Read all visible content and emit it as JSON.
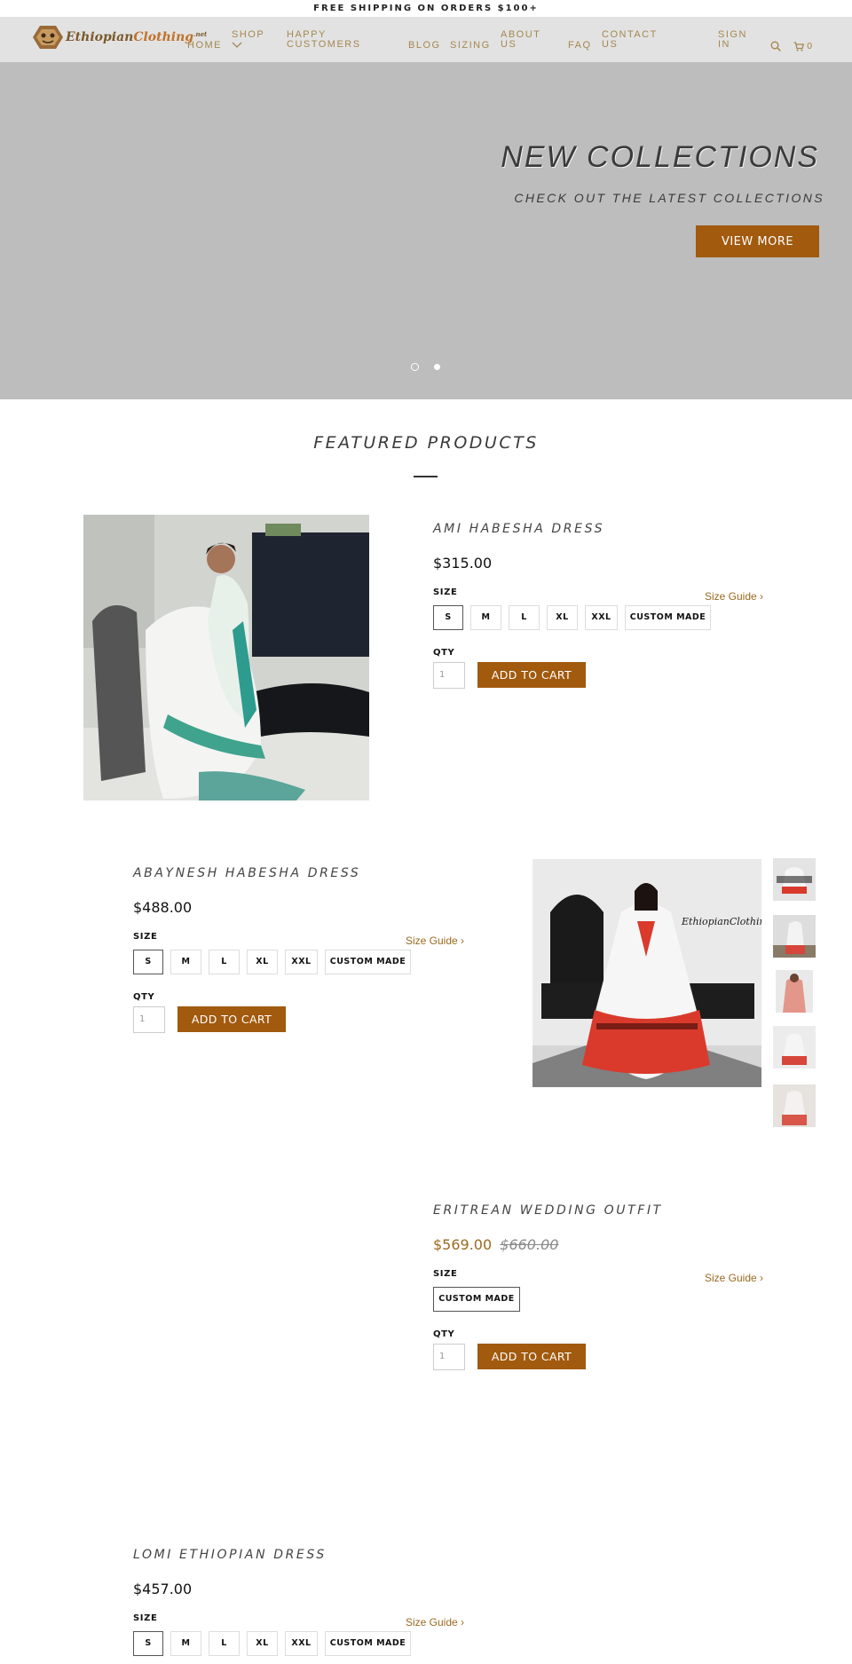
{
  "announcement": "FREE SHIPPING ON ORDERS $100+",
  "logo": {
    "text_main": "Ethiopian",
    "text_accent": "Clothing",
    "text_suffix": ".net"
  },
  "nav": {
    "home": "HOME",
    "shop": "SHOP",
    "happy_customers_1": "HAPPY",
    "happy_customers_2": "CUSTOMERS",
    "blog": "BLOG",
    "sizing": "SIZING",
    "about_1": "ABOUT",
    "about_2": "US",
    "faq": "FAQ",
    "contact_1": "CONTACT",
    "contact_2": "US",
    "signin_1": "SIGN",
    "signin_2": "IN",
    "cart_count": "0"
  },
  "hero": {
    "title": "NEW COLLECTIONS",
    "subtitle": "CHECK OUT THE LATEST COLLECTIONS",
    "button": "VIEW MORE"
  },
  "featured": {
    "title": "FEATURED PRODUCTS"
  },
  "labels": {
    "size": "SIZE",
    "qty": "QTY",
    "size_guide": "Size Guide ›",
    "add_to_cart": "ADD TO CART",
    "qty_default": "1"
  },
  "products": [
    {
      "name": "AMI HABESHA DRESS",
      "price": "$315.00",
      "sizes": [
        "S",
        "M",
        "L",
        "XL",
        "XXL",
        "CUSTOM MADE"
      ]
    },
    {
      "name": "ABAYNESH HABESHA DRESS",
      "price": "$488.00",
      "sizes": [
        "S",
        "M",
        "L",
        "XL",
        "XXL",
        "CUSTOM MADE"
      ]
    },
    {
      "name": "ERITREAN WEDDING OUTFIT",
      "price": "$569.00",
      "compare_price": "$660.00",
      "sizes": [
        "CUSTOM MADE"
      ]
    },
    {
      "name": "LOMI ETHIOPIAN DRESS",
      "price": "$457.00",
      "sizes": [
        "S",
        "M",
        "L",
        "XL",
        "XXL",
        "CUSTOM MADE"
      ]
    }
  ],
  "colors": {
    "accent": "#a15a0e",
    "nav_text": "#a4874f",
    "hero_bg": "#bdbdbd",
    "header_bg": "#e2e2e2"
  }
}
